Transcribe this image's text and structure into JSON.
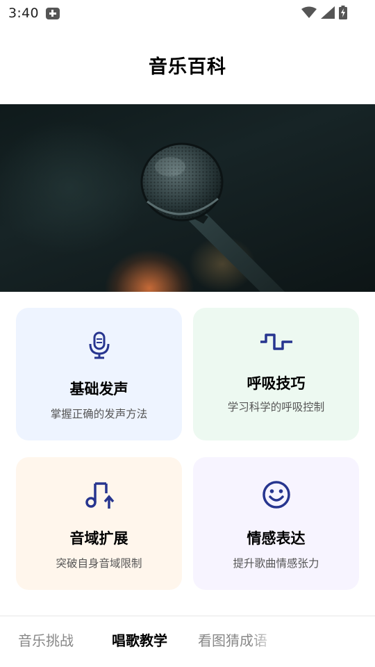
{
  "status_bar": {
    "time": "3:40",
    "icons": [
      "notification-plus-icon",
      "wifi-icon",
      "signal-icon",
      "battery-charging-icon"
    ]
  },
  "header": {
    "title": "音乐百科"
  },
  "banner": {
    "image": "microphone-photo"
  },
  "cards": [
    {
      "title": "基础发声",
      "subtitle": "掌握正确的发声方法",
      "icon": "microphone-icon",
      "bg": "#eef4ff"
    },
    {
      "title": "呼吸技巧",
      "subtitle": "学习科学的呼吸控制",
      "icon": "wave-icon",
      "bg": "#edf9f1"
    },
    {
      "title": "音域扩展",
      "subtitle": "突破自身音域限制",
      "icon": "music-note-up-icon",
      "bg": "#fff6ec"
    },
    {
      "title": "情感表达",
      "subtitle": "提升歌曲情感张力",
      "icon": "smiley-icon",
      "bg": "#f7f4ff"
    }
  ],
  "colors": {
    "icon": "#27358f",
    "title": "#000000",
    "subtitle": "#555555"
  },
  "tabs": [
    {
      "label": "音乐挑战",
      "active": false
    },
    {
      "label": "唱歌教学",
      "active": true
    },
    {
      "label": "看图猜成语",
      "active": false
    }
  ]
}
